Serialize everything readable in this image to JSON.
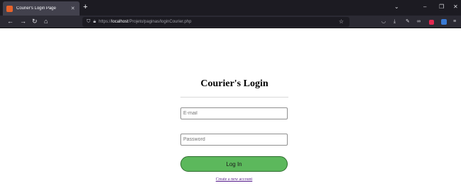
{
  "browser": {
    "tab": {
      "title": "Courier's Login Page",
      "close_icon": "close-icon",
      "favicon": "page-favicon-icon"
    },
    "new_tab_icon": "plus-icon",
    "window_controls": [
      "chevron-down-icon",
      "minimize-icon",
      "restore-icon",
      "close-icon"
    ],
    "nav": [
      "back-arrow-icon",
      "forward-arrow-icon",
      "reload-icon",
      "home-icon"
    ],
    "url": {
      "prefix": "https://",
      "host": "localhost",
      "path": "/Projeto/paginas/loginCourier.php"
    },
    "toolbar_icons": [
      "bookmark-star-icon",
      "pocket-icon",
      "download-icon",
      "wrench-icon",
      "mask-icon",
      "extension-red-icon",
      "extension-blue-icon",
      "menu-icon"
    ]
  },
  "login": {
    "title": "Courier's Login",
    "email_placeholder": "E-mail",
    "password_placeholder": "Password",
    "submit_label": "Log In",
    "create_account_link": "Create a new account"
  },
  "colors": {
    "button": "#5cb85c",
    "link": "#551a8b",
    "chrome_dark": "#1c1b22"
  }
}
